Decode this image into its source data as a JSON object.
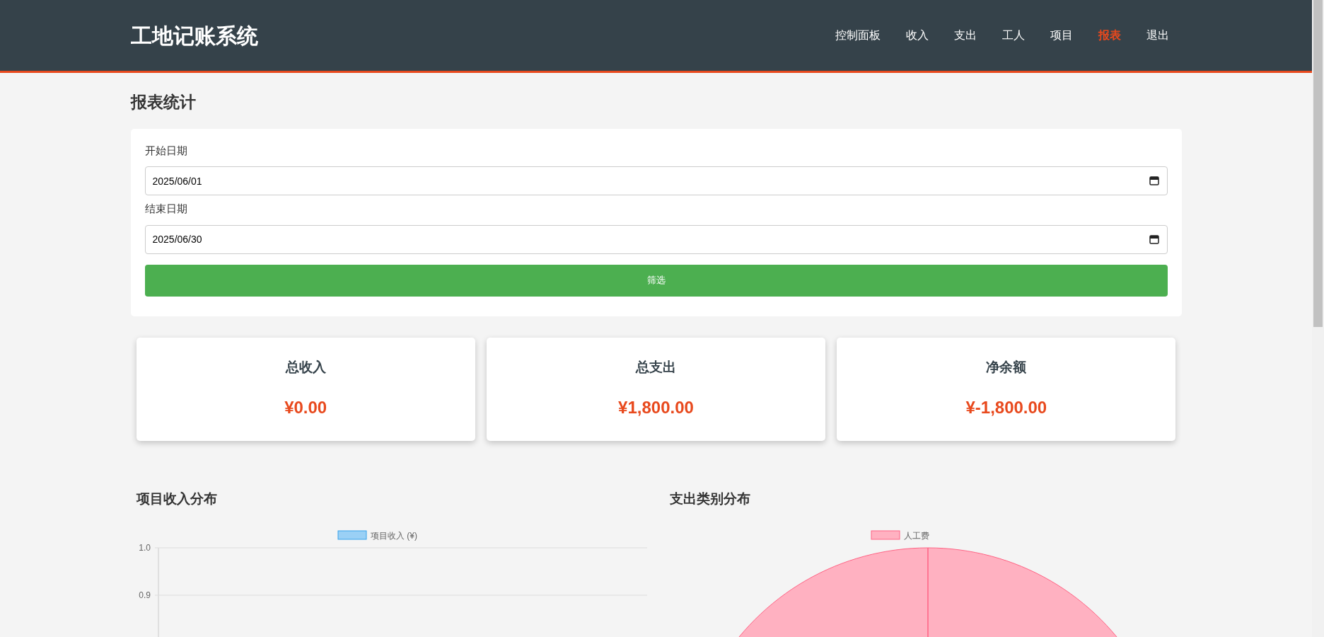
{
  "navbar": {
    "brand": "工地记账系统",
    "items": [
      {
        "label": "控制面板",
        "selected": false
      },
      {
        "label": "收入",
        "selected": false
      },
      {
        "label": "支出",
        "selected": false
      },
      {
        "label": "工人",
        "selected": false
      },
      {
        "label": "项目",
        "selected": false
      },
      {
        "label": "报表",
        "selected": true
      },
      {
        "label": "退出",
        "selected": false
      }
    ]
  },
  "page_title": "报表统计",
  "filter": {
    "fields": [
      {
        "label": "开始日期",
        "value": "2025/06/01"
      },
      {
        "label": "结束日期",
        "value": "2025/06/30"
      }
    ],
    "button": "筛选"
  },
  "summary": [
    {
      "title": "总收入",
      "value": "¥0.00"
    },
    {
      "title": "总支出",
      "value": "¥1,800.00"
    },
    {
      "title": "净余额",
      "value": "¥-1,800.00"
    }
  ],
  "charts": [
    {
      "title": "项目收入分布",
      "chart_data": {
        "type": "bar",
        "series": [
          {
            "name": "项目收入 (¥)",
            "color": "#9ad0f5"
          }
        ],
        "ylim": [
          0,
          1
        ],
        "yticks": [
          {
            "value": 1,
            "label": "1.0"
          },
          {
            "value": 0.9,
            "label": "0.9"
          }
        ]
      }
    },
    {
      "title": "支出类别分布",
      "chart_data": {
        "type": "pie",
        "categories": [
          "人工费"
        ],
        "series": [
          {
            "color": "#ffb1c1",
            "values": [
              100
            ]
          }
        ]
      }
    }
  ]
}
